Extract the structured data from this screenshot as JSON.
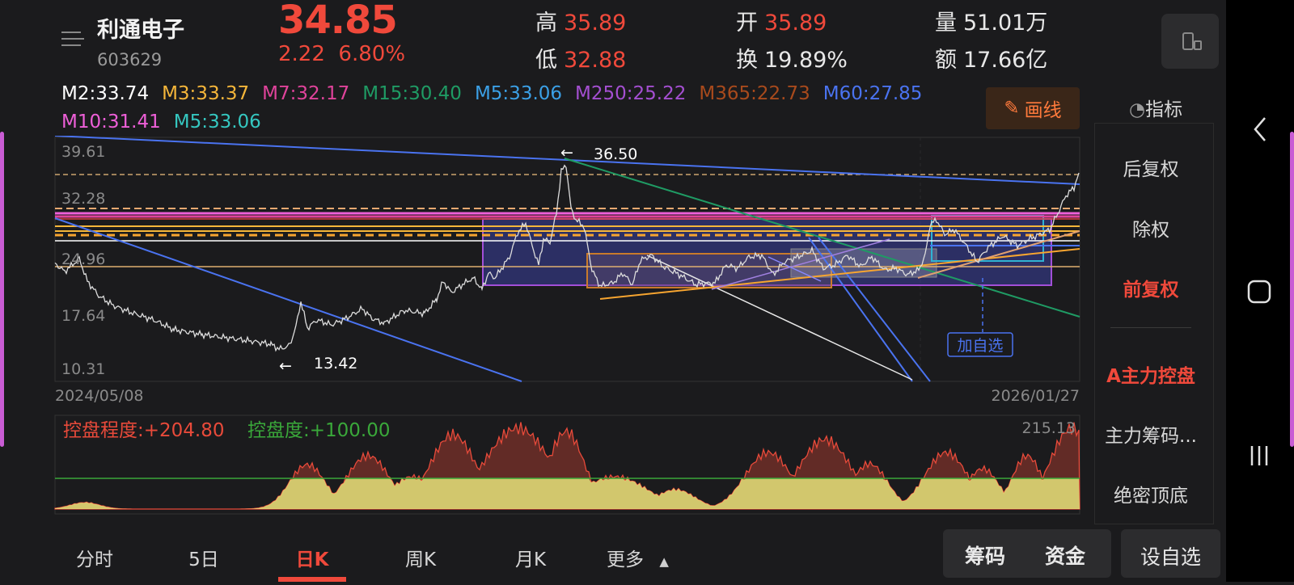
{
  "header": {
    "stock_name": "利通电子",
    "stock_code": "603629",
    "price": "34.85",
    "change": "2.22",
    "change_pct": "6.80%",
    "high_label": "高",
    "high": "35.89",
    "low_label": "低",
    "low": "32.88",
    "open_label": "开",
    "open": "35.89",
    "turnover_label": "换",
    "turnover": "19.89%",
    "volume_label": "量",
    "volume": "51.01万",
    "amount_label": "额",
    "amount": "17.66亿"
  },
  "ma_legend": [
    {
      "text": "M2:33.74",
      "color": "#ffffff"
    },
    {
      "text": "M3:33.37",
      "color": "#f5b63a"
    },
    {
      "text": "M7:32.17",
      "color": "#e0439b"
    },
    {
      "text": "M15:30.40",
      "color": "#1f9b64"
    },
    {
      "text": "M5:33.06",
      "color": "#3ba0e6"
    },
    {
      "text": "M250:25.22",
      "color": "#a44fd1"
    },
    {
      "text": "M365:22.73",
      "color": "#a84a1c"
    },
    {
      "text": "M60:27.85",
      "color": "#4a73f0"
    },
    {
      "text": "M10:31.41",
      "color": "#ee5fd8"
    },
    {
      "text": "M5:33.06",
      "color": "#35c7c0"
    }
  ],
  "draw_button": "画线",
  "indicator_label": "指标",
  "price_axis": [
    "39.61",
    "32.28",
    "24.96",
    "17.64",
    "10.31"
  ],
  "date_start": "2024/05/08",
  "date_end": "2026/01/27",
  "annotations": {
    "high_mark": "36.50",
    "low_mark": "13.42",
    "add_watch_tag": "加自选"
  },
  "sub_chart": {
    "control_label": "控盘程度:+204.80",
    "control_deg_label": "控盘度:+100.00",
    "max_label": "215.13",
    "colors": {
      "red": "#e84a3a",
      "yellow": "#e6e37a",
      "green": "#3aa83a"
    }
  },
  "side_menu": [
    "后复权",
    "除权",
    "前复权",
    "A主力控盘",
    "主力筹码...",
    "绝密顶底"
  ],
  "side_menu_active": [
    "前复权",
    "A主力控盘"
  ],
  "bottom_tabs": [
    "分时",
    "5日",
    "日K",
    "周K",
    "月K",
    "更多"
  ],
  "bottom_tab_active": "日K",
  "bottom_buttons": {
    "chips": "筹码",
    "funds": "资金",
    "watchlist": "设自选"
  },
  "colors": {
    "accent_red": "#f0493b",
    "background": "#1b1b1d",
    "price_line": "#dcdcdc"
  }
}
